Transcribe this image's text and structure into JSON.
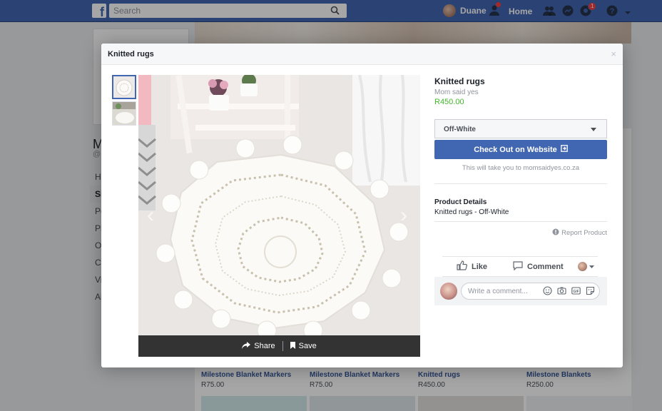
{
  "topbar": {
    "search_placeholder": "Search",
    "user_name": "Duane",
    "home_label": "Home",
    "notification_count": "1"
  },
  "background": {
    "page_name_initial": "M",
    "handle_initial": "@",
    "nav_items": [
      "He",
      "Sh",
      "Po",
      "Ph",
      "Of",
      "Co",
      "Vi",
      "Ab"
    ],
    "products": [
      {
        "name": "Milestone Blanket Markers",
        "price": "R75.00"
      },
      {
        "name": "Milestone Blanket Markers",
        "price": "R75.00"
      },
      {
        "name": "Knitted rugs",
        "price": "R450.00"
      },
      {
        "name": "Milestone Blankets",
        "price": "R250.00"
      }
    ]
  },
  "modal": {
    "title": "Knitted rugs",
    "close_glyph": "×",
    "photo_actions": {
      "share_label": "Share",
      "save_label": "Save"
    },
    "product": {
      "name": "Knitted rugs",
      "seller": "Mom said yes",
      "price": "R450.00"
    },
    "variant": {
      "selected": "Off-White"
    },
    "checkout_label": "Check Out on Website",
    "redirect_note": "This will take you to momsaidyes.co.za",
    "details_heading": "Product Details",
    "details_text": "Knitted rugs - Off-White",
    "report_label": "Report Product",
    "like_label": "Like",
    "comment_label": "Comment",
    "comment_placeholder": "Write a comment..."
  },
  "colors": {
    "brand_blue": "#4267b2",
    "price_green": "#42b72a",
    "notif_red": "#fa3e3e"
  }
}
